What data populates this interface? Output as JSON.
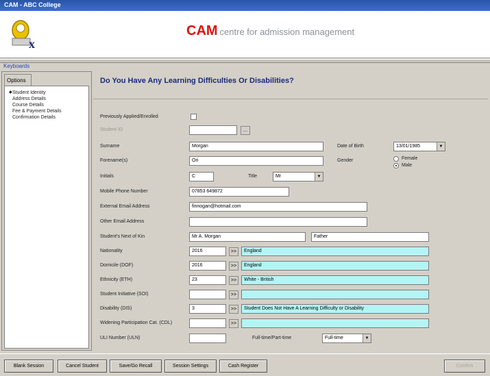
{
  "window": {
    "title": "CAM - ABC College"
  },
  "header": {
    "brand_bold": "CAM",
    "brand_rest": "centre for admission management"
  },
  "sidebar": {
    "heading": "Keyboards",
    "tab": "Options",
    "items": [
      {
        "label": "Student Identity"
      },
      {
        "label": "Address Details"
      },
      {
        "label": "Course Details"
      },
      {
        "label": "Fee & Payment Details"
      },
      {
        "label": "Confirmation Details"
      }
    ]
  },
  "main": {
    "question": "Do You Have Any Learning Difficulties Or Disabilities?",
    "fields": {
      "previously_applied": {
        "label": "Previously Applied/Enrolled",
        "checked": false
      },
      "student_id": {
        "label": "Student ID",
        "value": ""
      },
      "surname": {
        "label": "Surname",
        "value": "Morgan"
      },
      "forenames": {
        "label": "Forename(s)",
        "value": "Ori"
      },
      "initials": {
        "label": "Initials",
        "value": "C"
      },
      "title": {
        "label": "Title",
        "value": "Mr"
      },
      "mobile": {
        "label": "Mobile Phone Number",
        "value": "07853 649872"
      },
      "email": {
        "label": "External Email Address",
        "value": "finnogan@hotmail.com"
      },
      "other_email": {
        "label": "Other Email Address",
        "value": ""
      },
      "next_of_kin": {
        "label": "Student's Next of Kin",
        "name": "Mr A. Morgan",
        "relation": "Father"
      },
      "nationality": {
        "label": "Nationality",
        "code": "2016",
        "desc": "England"
      },
      "domicile": {
        "label": "Domicile (DOF)",
        "code": "2016",
        "desc": "England"
      },
      "ethnicity": {
        "label": "Ethnicity (ETH)",
        "code": "23",
        "desc": "White - British"
      },
      "student_initiative": {
        "label": "Student Initiative (SOI)",
        "code": "",
        "desc": ""
      },
      "disability": {
        "label": "Disability (DIS)",
        "code": "3",
        "desc": "Student Does Not Have A Learning Difficulty or Disability"
      },
      "widening": {
        "label": "Widening Participation Cat. (CDL)",
        "code": "",
        "desc": ""
      },
      "uln": {
        "label": "ULI Number (ULN)",
        "value": ""
      },
      "dob": {
        "label": "Date of Birth",
        "value": "13/01/1985"
      },
      "gender": {
        "label": "Gender",
        "female": "Female",
        "male": "Male",
        "selected": "Male"
      },
      "fulltime": {
        "label": "Full-time/Part-time",
        "value": "Full-time"
      }
    }
  },
  "toolbar": {
    "buttons": [
      {
        "label": "Blank Session"
      },
      {
        "label": "Cancel Student"
      },
      {
        "label": "Save/Go Recall"
      },
      {
        "label": "Session Settings"
      },
      {
        "label": "Cash Register"
      }
    ],
    "disabled_button": "Confirm"
  }
}
